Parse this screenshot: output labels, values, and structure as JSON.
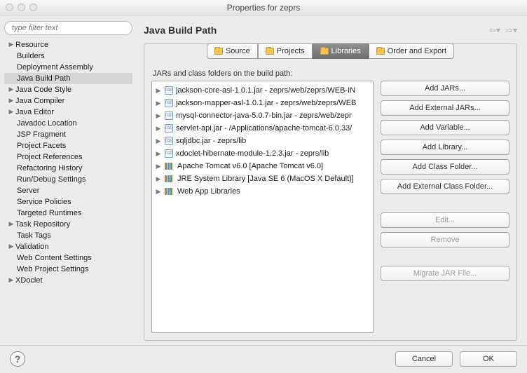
{
  "window": {
    "title": "Properties for zeprs"
  },
  "filter": {
    "placeholder": "type filter text"
  },
  "tree": [
    {
      "label": "Resource",
      "type": "parent"
    },
    {
      "label": "Builders",
      "type": "child"
    },
    {
      "label": "Deployment Assembly",
      "type": "child"
    },
    {
      "label": "Java Build Path",
      "type": "child",
      "selected": true
    },
    {
      "label": "Java Code Style",
      "type": "parent"
    },
    {
      "label": "Java Compiler",
      "type": "parent"
    },
    {
      "label": "Java Editor",
      "type": "parent"
    },
    {
      "label": "Javadoc Location",
      "type": "child"
    },
    {
      "label": "JSP Fragment",
      "type": "child"
    },
    {
      "label": "Project Facets",
      "type": "child"
    },
    {
      "label": "Project References",
      "type": "child"
    },
    {
      "label": "Refactoring History",
      "type": "child"
    },
    {
      "label": "Run/Debug Settings",
      "type": "child"
    },
    {
      "label": "Server",
      "type": "child"
    },
    {
      "label": "Service Policies",
      "type": "child"
    },
    {
      "label": "Targeted Runtimes",
      "type": "child"
    },
    {
      "label": "Task Repository",
      "type": "parent"
    },
    {
      "label": "Task Tags",
      "type": "child"
    },
    {
      "label": "Validation",
      "type": "parent"
    },
    {
      "label": "Web Content Settings",
      "type": "child"
    },
    {
      "label": "Web Project Settings",
      "type": "child"
    },
    {
      "label": "XDoclet",
      "type": "parent"
    }
  ],
  "main": {
    "title": "Java Build Path",
    "tabs": {
      "source": "Source",
      "projects": "Projects",
      "libraries": "Libraries",
      "order": "Order and Export",
      "active": "libraries"
    },
    "list_label": "JARs and class folders on the build path:",
    "entries": [
      {
        "icon": "jar",
        "text": "jackson-core-asl-1.0.1.jar - zeprs/web/zeprs/WEB-IN"
      },
      {
        "icon": "jar",
        "text": "jackson-mapper-asl-1.0.1.jar - zeprs/web/zeprs/WEB"
      },
      {
        "icon": "jar",
        "text": "mysql-connector-java-5.0.7-bin.jar - zeprs/web/zepr"
      },
      {
        "icon": "jar",
        "text": "servlet-api.jar - /Applications/apache-tomcat-6.0.33/"
      },
      {
        "icon": "jar",
        "text": "sqljdbc.jar - zeprs/lib"
      },
      {
        "icon": "jar",
        "text": "xdoclet-hibernate-module-1.2.3.jar - zeprs/lib"
      },
      {
        "icon": "lib",
        "text": "Apache Tomcat v6.0 [Apache Tomcat v6.0]"
      },
      {
        "icon": "lib",
        "text": "JRE System Library [Java SE 6 (MacOS X Default)]"
      },
      {
        "icon": "lib",
        "text": "Web App Libraries"
      }
    ],
    "buttons": {
      "add_jars": "Add JARs...",
      "add_ext_jars": "Add External JARs...",
      "add_variable": "Add Variable...",
      "add_library": "Add Library...",
      "add_class_folder": "Add Class Folder...",
      "add_ext_class_folder": "Add External Class Folder...",
      "edit": "Edit...",
      "remove": "Remove",
      "migrate": "Migrate JAR File..."
    }
  },
  "footer": {
    "cancel": "Cancel",
    "ok": "OK"
  }
}
